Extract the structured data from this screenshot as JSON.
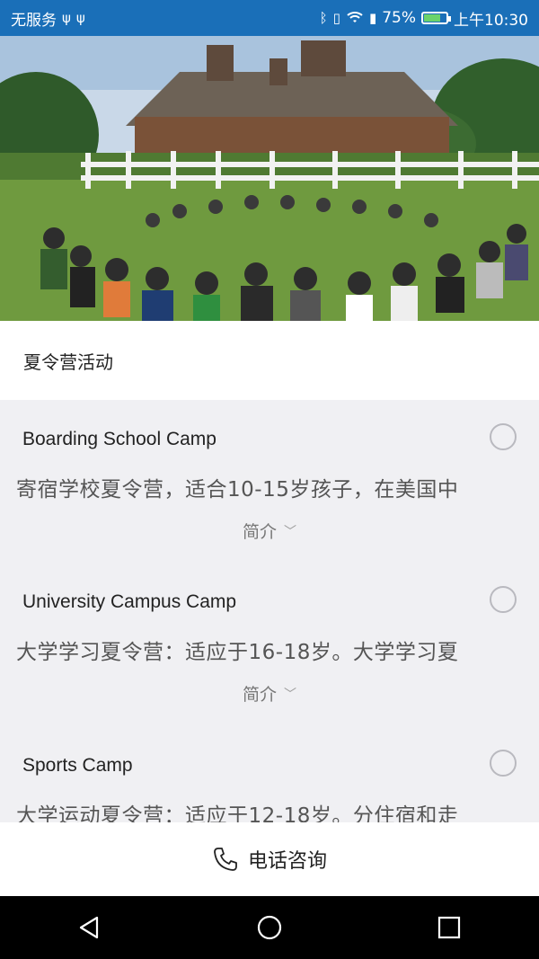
{
  "status_bar": {
    "carrier": "无服务",
    "icons_left": [
      "usb-icon",
      "usb-icon"
    ],
    "battery_percent": "75%",
    "battery_level": 0.75,
    "time": "上午10:30",
    "bg_color": "#1a6fb8"
  },
  "hero": {
    "image_desc_icon": "summer-camp-photo"
  },
  "section": {
    "title": "夏令营活动"
  },
  "camps": [
    {
      "title": "Boarding School Camp",
      "desc": "寄宿学校夏令营，适合10-15岁孩子，在美国中",
      "more": "简介",
      "selected": false
    },
    {
      "title": "University Campus Camp",
      "desc": "大学学习夏令营：适应于16-18岁。大学学习夏",
      "more": "简介",
      "selected": false
    },
    {
      "title": "Sports Camp",
      "desc": "大学运动夏令营：适应于12-18岁。分住宿和走",
      "more": "",
      "selected": false
    }
  ],
  "call": {
    "label": "电话咨询"
  }
}
